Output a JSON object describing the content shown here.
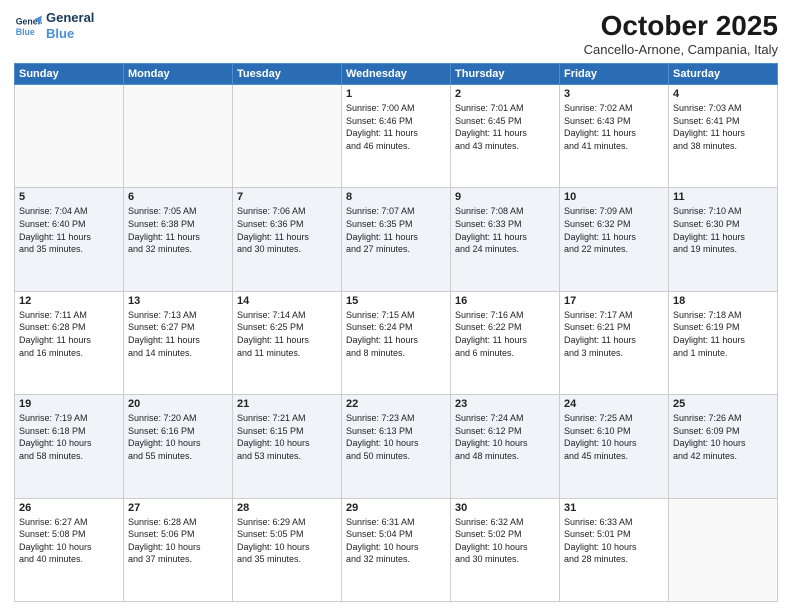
{
  "logo": {
    "line1": "General",
    "line2": "Blue"
  },
  "title": "October 2025",
  "subtitle": "Cancello-Arnone, Campania, Italy",
  "days_of_week": [
    "Sunday",
    "Monday",
    "Tuesday",
    "Wednesday",
    "Thursday",
    "Friday",
    "Saturday"
  ],
  "weeks": [
    [
      {
        "num": "",
        "info": ""
      },
      {
        "num": "",
        "info": ""
      },
      {
        "num": "",
        "info": ""
      },
      {
        "num": "1",
        "info": "Sunrise: 7:00 AM\nSunset: 6:46 PM\nDaylight: 11 hours\nand 46 minutes."
      },
      {
        "num": "2",
        "info": "Sunrise: 7:01 AM\nSunset: 6:45 PM\nDaylight: 11 hours\nand 43 minutes."
      },
      {
        "num": "3",
        "info": "Sunrise: 7:02 AM\nSunset: 6:43 PM\nDaylight: 11 hours\nand 41 minutes."
      },
      {
        "num": "4",
        "info": "Sunrise: 7:03 AM\nSunset: 6:41 PM\nDaylight: 11 hours\nand 38 minutes."
      }
    ],
    [
      {
        "num": "5",
        "info": "Sunrise: 7:04 AM\nSunset: 6:40 PM\nDaylight: 11 hours\nand 35 minutes."
      },
      {
        "num": "6",
        "info": "Sunrise: 7:05 AM\nSunset: 6:38 PM\nDaylight: 11 hours\nand 32 minutes."
      },
      {
        "num": "7",
        "info": "Sunrise: 7:06 AM\nSunset: 6:36 PM\nDaylight: 11 hours\nand 30 minutes."
      },
      {
        "num": "8",
        "info": "Sunrise: 7:07 AM\nSunset: 6:35 PM\nDaylight: 11 hours\nand 27 minutes."
      },
      {
        "num": "9",
        "info": "Sunrise: 7:08 AM\nSunset: 6:33 PM\nDaylight: 11 hours\nand 24 minutes."
      },
      {
        "num": "10",
        "info": "Sunrise: 7:09 AM\nSunset: 6:32 PM\nDaylight: 11 hours\nand 22 minutes."
      },
      {
        "num": "11",
        "info": "Sunrise: 7:10 AM\nSunset: 6:30 PM\nDaylight: 11 hours\nand 19 minutes."
      }
    ],
    [
      {
        "num": "12",
        "info": "Sunrise: 7:11 AM\nSunset: 6:28 PM\nDaylight: 11 hours\nand 16 minutes."
      },
      {
        "num": "13",
        "info": "Sunrise: 7:13 AM\nSunset: 6:27 PM\nDaylight: 11 hours\nand 14 minutes."
      },
      {
        "num": "14",
        "info": "Sunrise: 7:14 AM\nSunset: 6:25 PM\nDaylight: 11 hours\nand 11 minutes."
      },
      {
        "num": "15",
        "info": "Sunrise: 7:15 AM\nSunset: 6:24 PM\nDaylight: 11 hours\nand 8 minutes."
      },
      {
        "num": "16",
        "info": "Sunrise: 7:16 AM\nSunset: 6:22 PM\nDaylight: 11 hours\nand 6 minutes."
      },
      {
        "num": "17",
        "info": "Sunrise: 7:17 AM\nSunset: 6:21 PM\nDaylight: 11 hours\nand 3 minutes."
      },
      {
        "num": "18",
        "info": "Sunrise: 7:18 AM\nSunset: 6:19 PM\nDaylight: 11 hours\nand 1 minute."
      }
    ],
    [
      {
        "num": "19",
        "info": "Sunrise: 7:19 AM\nSunset: 6:18 PM\nDaylight: 10 hours\nand 58 minutes."
      },
      {
        "num": "20",
        "info": "Sunrise: 7:20 AM\nSunset: 6:16 PM\nDaylight: 10 hours\nand 55 minutes."
      },
      {
        "num": "21",
        "info": "Sunrise: 7:21 AM\nSunset: 6:15 PM\nDaylight: 10 hours\nand 53 minutes."
      },
      {
        "num": "22",
        "info": "Sunrise: 7:23 AM\nSunset: 6:13 PM\nDaylight: 10 hours\nand 50 minutes."
      },
      {
        "num": "23",
        "info": "Sunrise: 7:24 AM\nSunset: 6:12 PM\nDaylight: 10 hours\nand 48 minutes."
      },
      {
        "num": "24",
        "info": "Sunrise: 7:25 AM\nSunset: 6:10 PM\nDaylight: 10 hours\nand 45 minutes."
      },
      {
        "num": "25",
        "info": "Sunrise: 7:26 AM\nSunset: 6:09 PM\nDaylight: 10 hours\nand 42 minutes."
      }
    ],
    [
      {
        "num": "26",
        "info": "Sunrise: 6:27 AM\nSunset: 5:08 PM\nDaylight: 10 hours\nand 40 minutes."
      },
      {
        "num": "27",
        "info": "Sunrise: 6:28 AM\nSunset: 5:06 PM\nDaylight: 10 hours\nand 37 minutes."
      },
      {
        "num": "28",
        "info": "Sunrise: 6:29 AM\nSunset: 5:05 PM\nDaylight: 10 hours\nand 35 minutes."
      },
      {
        "num": "29",
        "info": "Sunrise: 6:31 AM\nSunset: 5:04 PM\nDaylight: 10 hours\nand 32 minutes."
      },
      {
        "num": "30",
        "info": "Sunrise: 6:32 AM\nSunset: 5:02 PM\nDaylight: 10 hours\nand 30 minutes."
      },
      {
        "num": "31",
        "info": "Sunrise: 6:33 AM\nSunset: 5:01 PM\nDaylight: 10 hours\nand 28 minutes."
      },
      {
        "num": "",
        "info": ""
      }
    ]
  ]
}
